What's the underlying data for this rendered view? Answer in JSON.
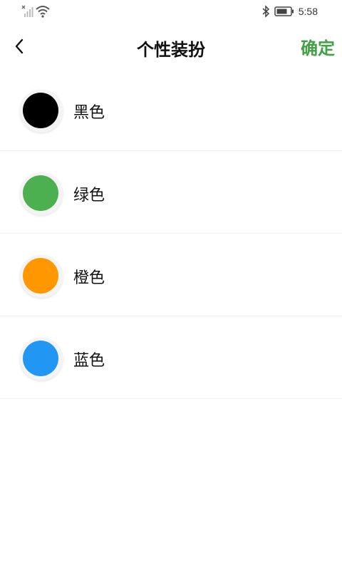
{
  "status_bar": {
    "time": "5:58",
    "icons": [
      "no-signal-icon",
      "wifi-icon",
      "bluetooth-icon",
      "battery-icon"
    ]
  },
  "header": {
    "title": "个性装扮",
    "confirm_label": "确定",
    "back_icon": "chevron-left-icon"
  },
  "colors": {
    "accent": "#43a047"
  },
  "options": [
    {
      "label": "黑色",
      "color": "#000000"
    },
    {
      "label": "绿色",
      "color": "#4caf50"
    },
    {
      "label": "橙色",
      "color": "#ff9800"
    },
    {
      "label": "蓝色",
      "color": "#2196f3"
    }
  ]
}
